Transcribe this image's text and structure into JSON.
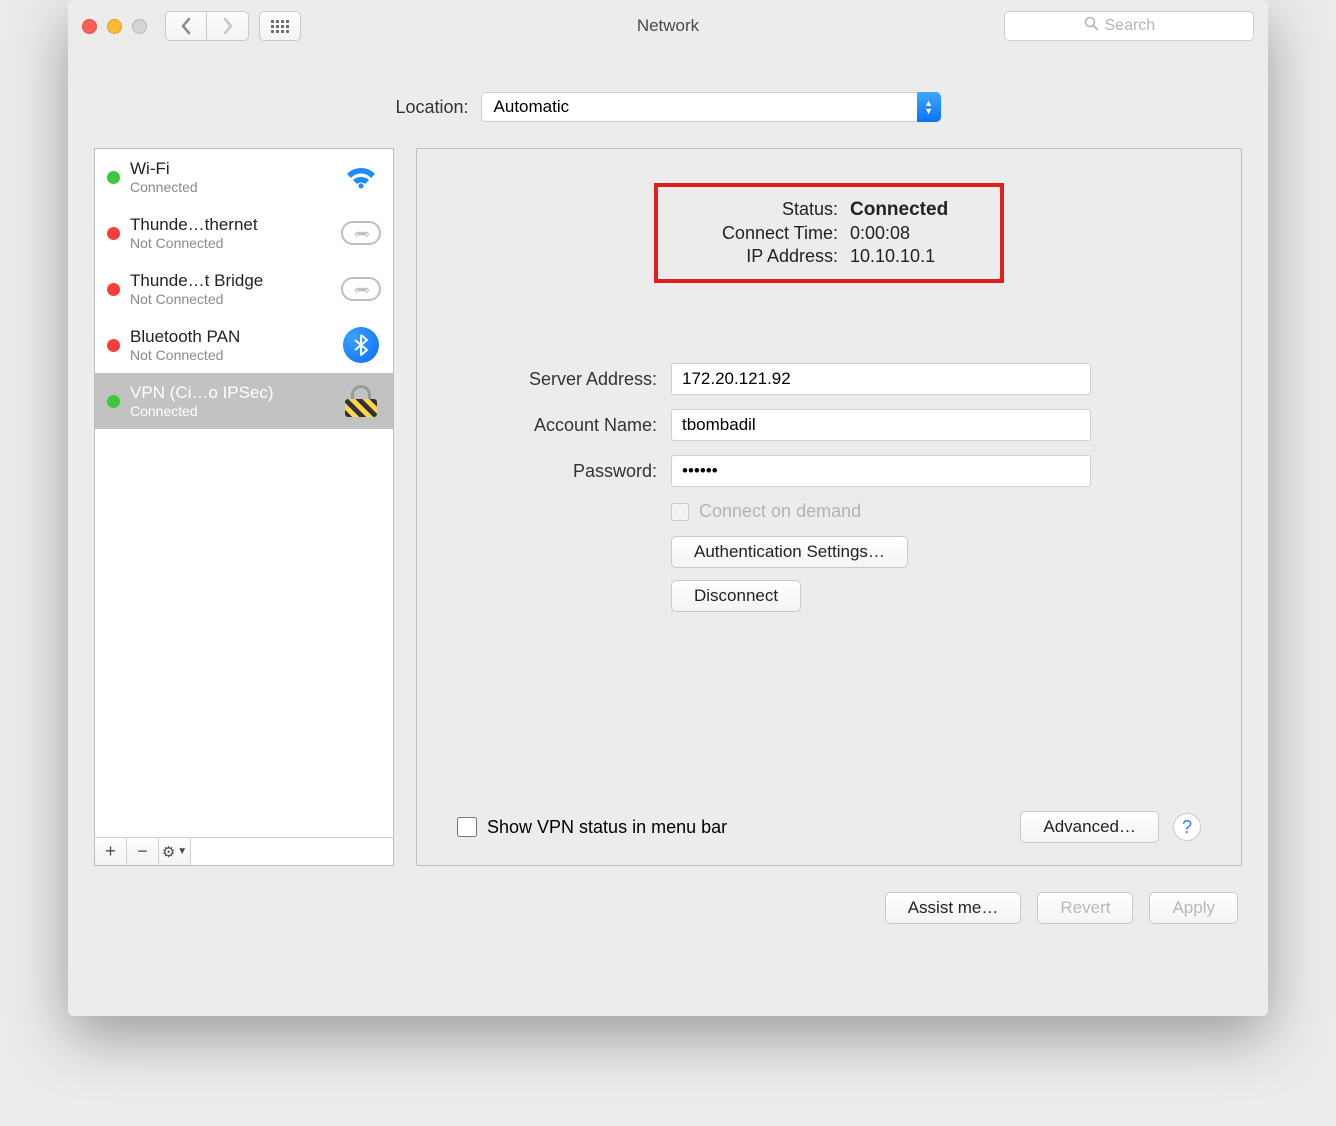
{
  "window": {
    "title": "Network"
  },
  "search": {
    "placeholder": "Search"
  },
  "location": {
    "label": "Location:",
    "value": "Automatic"
  },
  "sidebar": {
    "items": [
      {
        "name": "Wi-Fi",
        "status": "Connected",
        "dot": "green",
        "icon": "wifi"
      },
      {
        "name": "Thunde…thernet",
        "status": "Not Connected",
        "dot": "red",
        "icon": "ethernet"
      },
      {
        "name": "Thunde…t Bridge",
        "status": "Not Connected",
        "dot": "red",
        "icon": "ethernet"
      },
      {
        "name": "Bluetooth PAN",
        "status": "Not Connected",
        "dot": "red",
        "icon": "bluetooth"
      },
      {
        "name": "VPN (Ci…o IPSec)",
        "status": "Connected",
        "dot": "green",
        "icon": "lock",
        "selected": true
      }
    ],
    "toolbar": {
      "add": "+",
      "remove": "−",
      "options": "⚙︎"
    }
  },
  "detail": {
    "status_label": "Status:",
    "status_value": "Connected",
    "connect_time_label": "Connect Time:",
    "connect_time_value": "0:00:08",
    "ip_label": "IP Address:",
    "ip_value": "10.10.10.1",
    "server_label": "Server Address:",
    "server_value": "172.20.121.92",
    "account_label": "Account Name:",
    "account_value": "tbombadil",
    "password_label": "Password:",
    "password_value": "••••••",
    "connect_on_demand": "Connect on demand",
    "auth_settings": "Authentication Settings…",
    "disconnect": "Disconnect",
    "show_vpn": "Show VPN status in menu bar",
    "advanced": "Advanced…",
    "help": "?"
  },
  "footer": {
    "assist": "Assist me…",
    "revert": "Revert",
    "apply": "Apply"
  }
}
